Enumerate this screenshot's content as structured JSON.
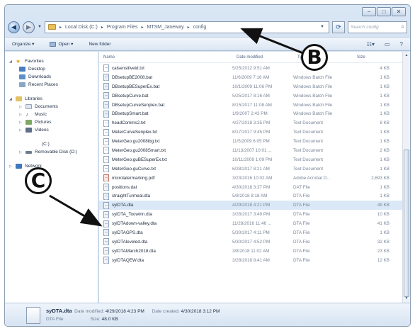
{
  "window": {
    "caption_buttons": [
      "−",
      "□",
      "✕"
    ]
  },
  "address": {
    "back_glyph": "◀",
    "forward_glyph": "▶",
    "crumbs": [
      "Local Disk (C:)",
      "Program Files",
      "MTSM_Janeway",
      "config"
    ],
    "search_placeholder": "Search config"
  },
  "toolbar": {
    "organize_label": "Organize ▾",
    "open_label": "Open ▾",
    "new_folder_label": "New folder"
  },
  "nav": {
    "favorites_label": "Favorites",
    "desktop_label": "Desktop",
    "downloads_label": "Downloads",
    "recent_label": "Recent Places",
    "libraries_label": "Libraries",
    "documents_label": "Documents",
    "music_label": "Music",
    "pictures_label": "Pictures",
    "videos_label": "Videos",
    "drive_label": "(C:)",
    "removable_label": "Removable Disk (D:)",
    "network_label": "Network"
  },
  "columns": {
    "name": "Name",
    "date": "Date modified",
    "type": "Type",
    "size": "Size"
  },
  "files": [
    {
      "name": "calsensitiveid.txt",
      "date": "5/25/2012 9:51 AM",
      "type": "",
      "size": "4 KB",
      "icon": "txt"
    },
    {
      "name": "DBsetupBE2008.bat",
      "date": "11/6/2009 7:16 AM",
      "type": "Windows Batch File",
      "size": "1 KB",
      "icon": "bat"
    },
    {
      "name": "DBsetupBESuperEx.bat",
      "date": "10/1/2009 11:06 PM",
      "type": "Windows Batch File",
      "size": "1 KB",
      "icon": "bat"
    },
    {
      "name": "DBsetupCurve.bat",
      "date": "5/25/2017 8:16 AM",
      "type": "Windows Batch File",
      "size": "1 KB",
      "icon": "bat"
    },
    {
      "name": "DBsetupCurveSenplex.bat",
      "date": "8/15/2017 11:08 AM",
      "type": "Windows Batch File",
      "size": "1 KB",
      "icon": "bat"
    },
    {
      "name": "DBsetupSmart.bat",
      "date": "1/9/2007 2:43 PM",
      "type": "Windows Batch File",
      "size": "1 KB",
      "icon": "bat"
    },
    {
      "name": "headComms2.txt",
      "date": "4/27/2018 3:35 PM",
      "type": "Text Document",
      "size": "8 KB",
      "icon": "txt"
    },
    {
      "name": "MeterCurveSenplex.txt",
      "date": "8/17/2017 9:45 PM",
      "type": "Text Document",
      "size": "1 KB",
      "icon": "txt"
    },
    {
      "name": "MeterGeo.gu2008ibg.txt",
      "date": "11/5/2009 6:05 PM",
      "type": "Text Document",
      "size": "1 KB",
      "icon": "txt"
    },
    {
      "name": "MeterGeo.gu2008Smart.txt",
      "date": "11/13/2007 10:01 ...",
      "type": "Text Document",
      "size": "2 KB",
      "icon": "txt"
    },
    {
      "name": "MeterGeo.guBESuperEx.txt",
      "date": "10/11/2009 1:09 PM",
      "type": "Text Document",
      "size": "1 KB",
      "icon": "txt"
    },
    {
      "name": "MeterGeo.guCurve.txt",
      "date": "6/28/2017 8:21 AM",
      "type": "Text Document",
      "size": "1 KB",
      "icon": "txt"
    },
    {
      "name": "microlatermarking.pdf",
      "date": "3/23/2016 10:02 AM",
      "type": "Adobe Acrobat D...",
      "size": "2,693 KB",
      "icon": "pdf"
    },
    {
      "name": "positions.dat",
      "date": "4/30/2018 3:37 PM",
      "type": "DAT File",
      "size": "1 KB",
      "icon": "dta"
    },
    {
      "name": "straightTurmeal.dta",
      "date": "5/8/2018 8:18 AM",
      "type": "DTA File",
      "size": "1 KB",
      "icon": "dta"
    },
    {
      "name": "sylDTA.dta",
      "date": "4/29/2018 4:21 PM",
      "type": "DTA File",
      "size": "49 KB",
      "icon": "dta"
    },
    {
      "name": "sylDTA_Toowinn.dta",
      "date": "3/28/2017 3:49 PM",
      "type": "DTA File",
      "size": "10 KB",
      "icon": "dta"
    },
    {
      "name": "sylDTAdown-valley.dta",
      "date": "11/28/2016 11:46 ...",
      "type": "DTA File",
      "size": "41 KB",
      "icon": "dta"
    },
    {
      "name": "sylDTAGPS.dta",
      "date": "5/30/2017 4:11 PM",
      "type": "DTA File",
      "size": "1 KB",
      "icon": "dta"
    },
    {
      "name": "sylDTAleveled.dta",
      "date": "5/30/2017 4:52 PM",
      "type": "DTA File",
      "size": "32 KB",
      "icon": "dta"
    },
    {
      "name": "sylDTAMarch2018.dta",
      "date": "3/8/2018 11:02 AM",
      "type": "DTA File",
      "size": "23 KB",
      "icon": "dta"
    },
    {
      "name": "sylDTAQEW.dta",
      "date": "3/28/2018 8:41 AM",
      "type": "DTA File",
      "size": "12 KB",
      "icon": "dta"
    }
  ],
  "details": {
    "name": "syDTA.dta",
    "date_modified_label": "Date modified:",
    "date_modified": "4/29/2018 4:23 PM",
    "date_created_label": "Date created:",
    "date_created": "4/30/2018 3:12 PM",
    "type": "DTA File",
    "size_label": "Size:",
    "size": "48.0 KB"
  },
  "callouts": {
    "b": "B",
    "c": "C"
  }
}
